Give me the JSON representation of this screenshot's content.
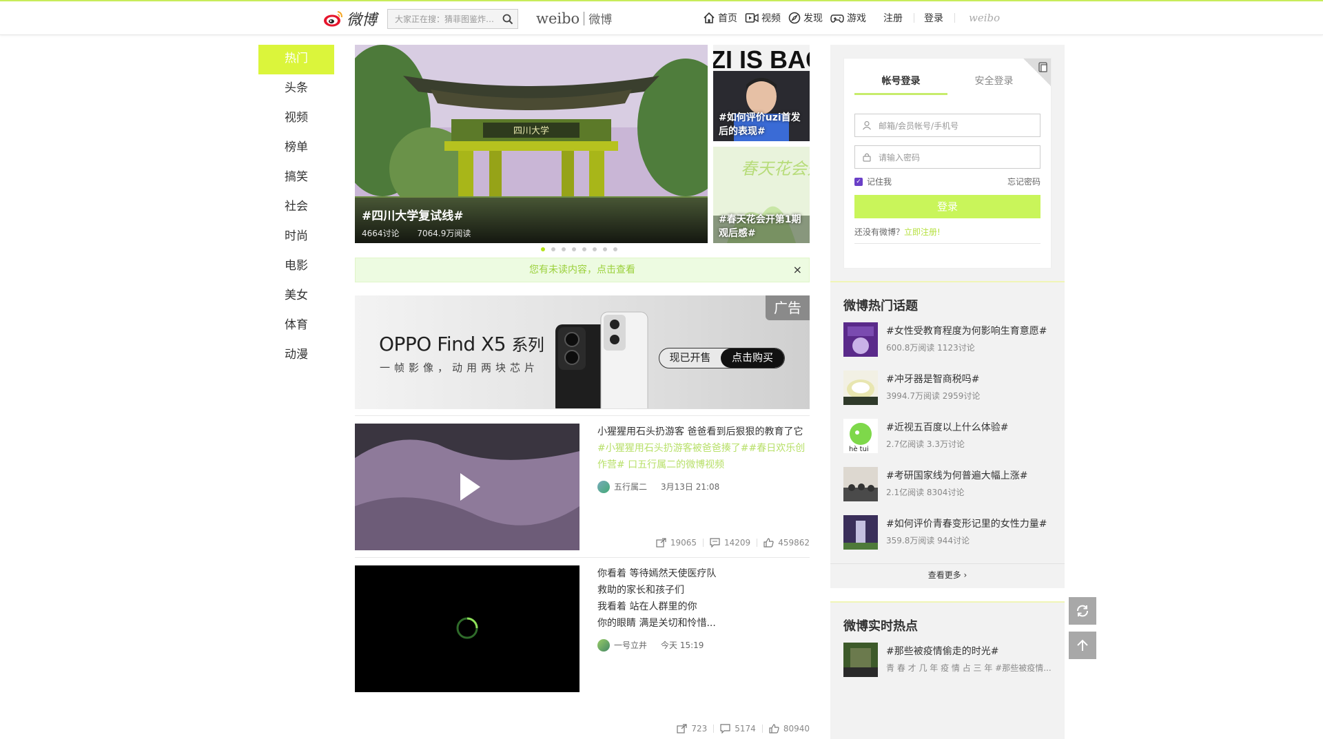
{
  "header": {
    "logo_text": "微博",
    "search_placeholder": "大家正在搜：猜菲图鉴炸…",
    "brand_en": "weibo",
    "brand_cn": "微博",
    "nav": [
      {
        "label": "首页",
        "icon": "home-icon"
      },
      {
        "label": "视频",
        "icon": "video-icon"
      },
      {
        "label": "发现",
        "icon": "compass-icon"
      },
      {
        "label": "游戏",
        "icon": "gamepad-icon"
      }
    ],
    "register": "注册",
    "login": "登录",
    "weibo_mark": "weibo"
  },
  "leftnav": {
    "items": [
      "热门",
      "头条",
      "视频",
      "榜单",
      "搞笑",
      "社会",
      "时尚",
      "电影",
      "美女",
      "体育",
      "动漫"
    ],
    "active_index": 0
  },
  "carousel": {
    "main": {
      "title": "#四川大学复试线#",
      "discuss": "4664讨论",
      "reads": "7064.9万阅读",
      "gate_text": "四川大学"
    },
    "side": [
      {
        "caption": "#如何评价uzi首发后的表现#",
        "banner_text": "ZI IS BAC"
      },
      {
        "caption": "#春天花会开第1期观后感#",
        "art_text": "春天花会开"
      }
    ],
    "dots": 8,
    "active_dot": 0
  },
  "unread": {
    "text": "您有未读内容，点击查看",
    "close": "×"
  },
  "ad": {
    "tag": "广告",
    "headline_en": "OPPO Find X5",
    "headline_cn": "系列",
    "subline": "一帧影像，动用两块芯片",
    "btn_a": "现已开售",
    "btn_b": "点击购买"
  },
  "posts": [
    {
      "text": "小猩猩用石头扔游客 爸爸看到后狠狠的教育了它",
      "tags": "#小猩猩用石头扔游客被爸爸揍了##春日欢乐创作营# 口五行属二的微博视频",
      "author": "五行属二",
      "time": "3月13日 21:08",
      "shares": "19065",
      "comments": "14209",
      "likes": "459862"
    },
    {
      "lines": [
        "你看着 等待嫣然天使医疗队",
        "救助的家长和孩子们",
        "我看着 站在人群里的你",
        "你的眼睛 满是关切和怜惜..."
      ],
      "author": "一号立井",
      "time": "今天 15:19",
      "shares": "723",
      "comments": "5174",
      "likes": "80940"
    }
  ],
  "login": {
    "tab_account": "帐号登录",
    "tab_secure": "安全登录",
    "user_placeholder": "邮箱/会员帐号/手机号",
    "pass_placeholder": "请输入密码",
    "remember": "记住我",
    "forgot": "忘记密码",
    "submit": "登录",
    "no_account": "还没有微博？",
    "register_now": "立即注册!"
  },
  "hot_topics": {
    "title": "微博热门话题",
    "items": [
      {
        "title": "#女性受教育程度为何影响生育意愿#",
        "meta": "600.8万阅读 1123讨论"
      },
      {
        "title": "#冲牙器是智商税吗#",
        "meta": "3994.7万阅读 2959讨论"
      },
      {
        "title": "#近视五百度以上什么体验#",
        "meta": "2.7亿阅读 3.3万讨论"
      },
      {
        "title": "#考研国家线为何普遍大幅上涨#",
        "meta": "2.1亿阅读 8304讨论"
      },
      {
        "title": "#如何评价青春变形记里的女性力量#",
        "meta": "359.8万阅读 944讨论"
      }
    ],
    "more": "查看更多 ›"
  },
  "realtime": {
    "title": "微博实时热点",
    "items": [
      {
        "title": "#那些被疫情偷走的时光#",
        "meta": "青 春 才 几 年 疫 情 占 三 年 #那些被疫情..."
      }
    ]
  }
}
